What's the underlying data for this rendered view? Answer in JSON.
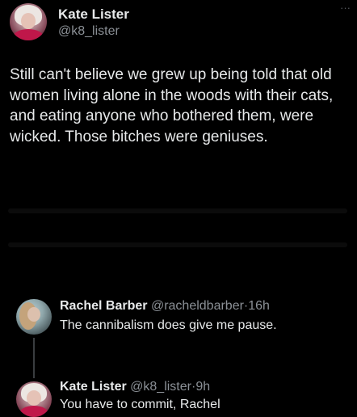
{
  "main_tweet": {
    "author_name": "Kate Lister",
    "author_handle": "@k8_lister",
    "more_icon": "···",
    "text": "Still can't believe we grew up being told that old women living alone in the woods with their cats, and eating anyone who bothered them, were wicked. Those bitches were geniuses."
  },
  "replies": [
    {
      "author_name": "Rachel Barber",
      "author_handle": "@racheldbarber",
      "separator": "·",
      "time": "16h",
      "text": "The cannibalism does give me pause."
    },
    {
      "author_name": "Kate Lister",
      "author_handle": "@k8_lister",
      "separator": "·",
      "time": "9h",
      "text": "You have to commit, Rachel"
    }
  ],
  "colors": {
    "background": "#000000",
    "primary_text": "#e7e9ea",
    "secondary_text": "#8b9096",
    "thread_line": "#3a3d40"
  }
}
